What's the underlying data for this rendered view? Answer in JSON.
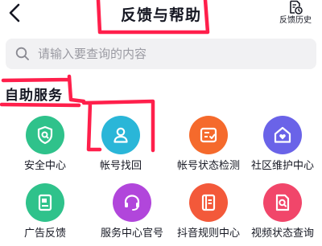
{
  "header": {
    "title": "反馈与帮助",
    "history_label": "反馈历史",
    "back_icon": "back-arrow-icon",
    "history_icon": "document-clock-icon"
  },
  "search": {
    "placeholder": "请输入要查询的内容",
    "value": "",
    "icon": "search-icon"
  },
  "section": {
    "title": "自助服务"
  },
  "services": [
    {
      "label": "安全中心",
      "icon": "shield-icon",
      "color": "#2fc28b"
    },
    {
      "label": "帐号找回",
      "icon": "user-icon",
      "color": "#2ab6d8"
    },
    {
      "label": "帐号状态检测",
      "icon": "checklist-icon",
      "color": "#f56a2c"
    },
    {
      "label": "社区维护中心",
      "icon": "home-heart-icon",
      "color": "#6a63e8"
    },
    {
      "label": "广告反馈",
      "icon": "document-flag-icon",
      "color": "#2fc28b"
    },
    {
      "label": "服务中心官号",
      "icon": "headset-icon",
      "color": "#b146db"
    },
    {
      "label": "抖音规则中心",
      "icon": "book-icon",
      "color": "#f3593a"
    },
    {
      "label": "视频状态查询",
      "icon": "document-search-icon",
      "color": "#f1466a"
    }
  ],
  "annotation_color": "#ff1f4b"
}
